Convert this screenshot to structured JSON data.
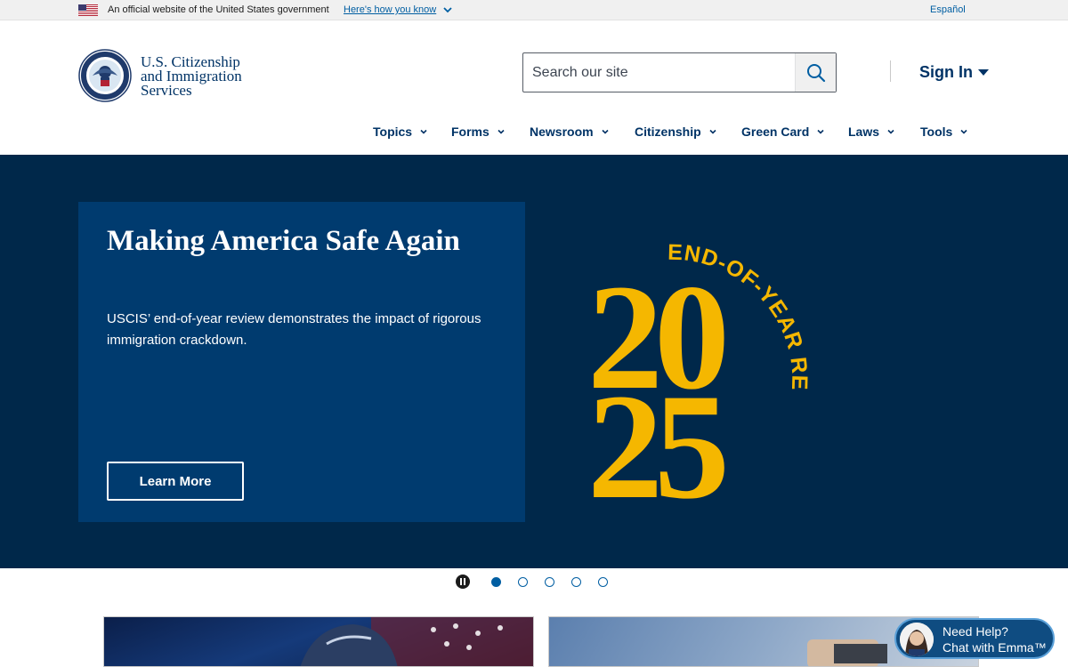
{
  "gov_banner": {
    "official_text": "An official website of the United States government",
    "how_you_know": "Here's how you know",
    "language": "Español"
  },
  "header": {
    "logo_lines": [
      "U.S. Citizenship",
      "and Immigration",
      "Services"
    ],
    "search_placeholder": "Search our site",
    "signin_label": "Sign In"
  },
  "nav": {
    "items": [
      "Topics",
      "Forms",
      "Newsroom",
      "Citizenship",
      "Green Card",
      "Laws",
      "Tools"
    ]
  },
  "hero": {
    "title": "Making America Safe Again",
    "description": "USCIS’ end-of-year review demonstrates the impact of rigorous immigration crackdown.",
    "button_label": "Learn More",
    "art_year": "2025",
    "art_caption": "END-OF-YEAR REVIEW",
    "art_color": "#f5b700"
  },
  "carousel": {
    "slide_count": 5,
    "active_index": 0
  },
  "chat": {
    "line1": "Need Help?",
    "line2": "Chat with Emma™"
  },
  "colors": {
    "navy": "#003366",
    "hero_bg": "#00284a",
    "card_bg": "#003b6f",
    "link": "#005ea2"
  }
}
